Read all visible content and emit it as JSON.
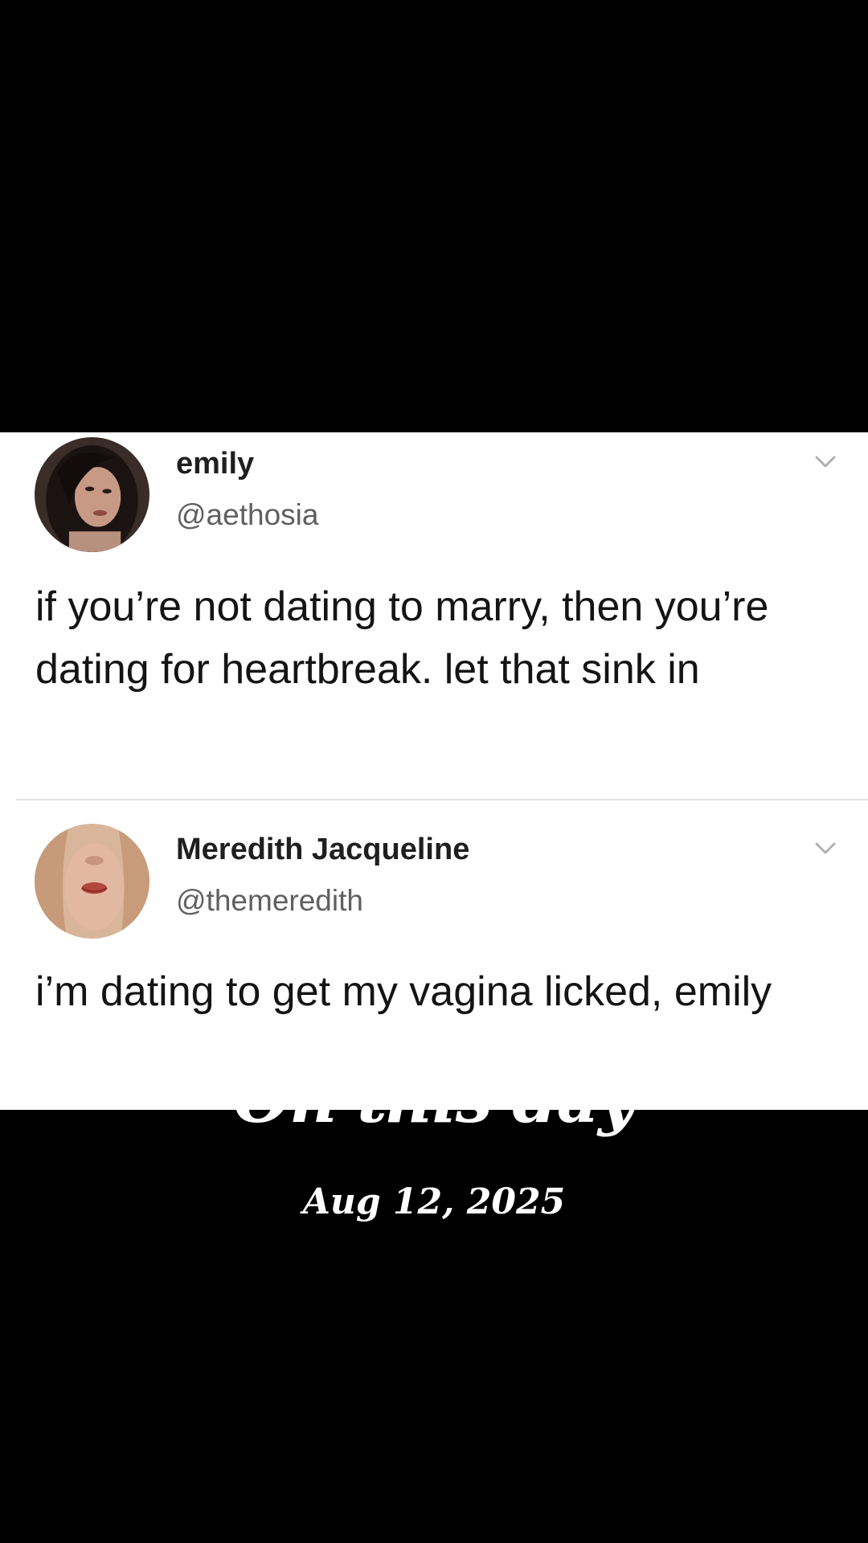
{
  "tweets": [
    {
      "display_name": "emily",
      "handle": "@aethosia",
      "text": "if you’re not dating to marry, then you’re dating for heartbreak. let that sink in",
      "avatar_icon": "profile-photo-dark-hair",
      "menu_icon": "chevron-down-icon"
    },
    {
      "display_name": "Meredith Jacqueline",
      "handle": "@themeredith",
      "text": "i’m dating to get my vagina licked, emily",
      "avatar_icon": "profile-photo-blonde-hair",
      "menu_icon": "chevron-down-icon"
    }
  ],
  "overlay": {
    "title": "On this day",
    "date": "Aug 12, 2025"
  },
  "colors": {
    "background": "#000000",
    "card": "#ffffff",
    "text": "#141414",
    "handle": "#606060",
    "divider": "#e2e2e2",
    "overlay_text": "#ffffff"
  }
}
